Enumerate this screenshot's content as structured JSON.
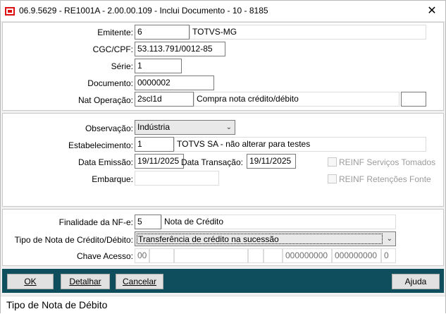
{
  "window": {
    "title": "06.9.5629 - RE1001A - 2.00.00.109 - Inclui Documento - 10 - 8185",
    "close_glyph": "✕"
  },
  "header": {
    "emitente_label": "Emitente:",
    "emitente_value": "6",
    "emitente_name": "TOTVS-MG",
    "cgc_label": "CGC/CPF:",
    "cgc_value": "53.113.791/0012-85",
    "serie_label": "Série:",
    "serie_value": "1",
    "documento_label": "Documento:",
    "documento_value": "0000002",
    "nat_label": "Nat Operação:",
    "nat_value": "2scl1d",
    "nat_desc": "Compra nota crédito/débito",
    "nat_extra": ""
  },
  "middle": {
    "observacao_label": "Observação:",
    "observacao_value": "Indústria",
    "estab_label": "Estabelecimento:",
    "estab_value": "1",
    "estab_name": "TOTVS SA - não alterar para testes",
    "emissao_label": "Data Emissão:",
    "emissao_value": "19/11/2025",
    "transacao_label": "Data Transação:",
    "transacao_value": "19/11/2025",
    "embarque_label": "Embarque:",
    "embarque_value": "",
    "reinf_servicos": "REINF Serviços Tomados",
    "reinf_retencoes": "REINF Retenções Fonte"
  },
  "nfe": {
    "finalidade_label": "Finalidade da NF-e:",
    "finalidade_value": "5",
    "finalidade_desc": "Nota de Crédito",
    "tipo_label": "Tipo de Nota de Crédito/Débito:",
    "tipo_value": "Transferência de crédito na sucessão",
    "chave_label": "Chave Acesso:",
    "chave_parts": [
      "00",
      "",
      "",
      "",
      "",
      "000000000",
      "000000000",
      "0"
    ]
  },
  "toolbar": {
    "ok": "OK",
    "detalhar": "Detalhar",
    "cancelar": "Cancelar",
    "ajuda": "Ajuda"
  },
  "status": {
    "text": "Tipo de Nota de Débito"
  },
  "colors": {
    "toolbar_bg": "#0f4f5d",
    "disabled_text": "#9b9b9b"
  }
}
